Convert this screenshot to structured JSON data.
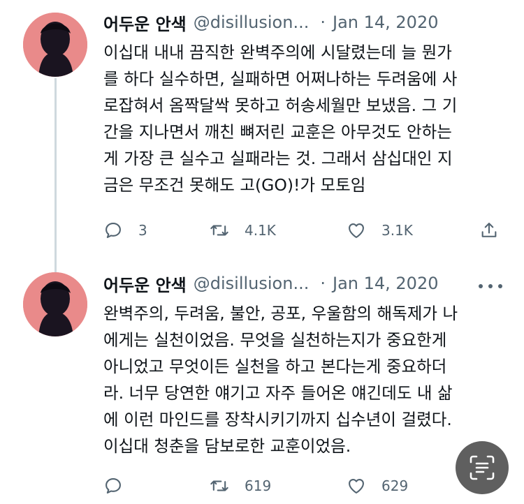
{
  "tweets": [
    {
      "name": "어두운 안색",
      "handle": "@disillusion...",
      "separator": "·",
      "date": "Jan 14, 2020",
      "lines": [
        "이십대 내내 끔직한 완벽주의에 시달렸는데 늘 뭔가",
        "를 하다 실수하면, 실패하면 어쩌나하는 두려움에 사",
        "로잡혀서 옴짝달싹 못하고 허송세월만 보냈음. 그 기",
        "간을 지나면서 깨친 뼈저린 교훈은 아무것도 안하는",
        "게 가장 큰 실수고 실패라는 것. 그래서 삼십대인 지",
        "금은 무조건 못해도 고(GO)!가 모토임"
      ],
      "reply_count": "3",
      "retweet_count": "4.1K",
      "like_count": "3.1K"
    },
    {
      "name": "어두운 안색",
      "handle": "@disillusion...",
      "separator": "·",
      "date": "Jan 14, 2020",
      "lines": [
        "완벽주의, 두려움, 불안, 공포, 우울함의 해독제가 나",
        "에게는 실천이었음. 무엇을 실천하는지가 중요한게",
        "아니었고 무엇이든 실천을 하고 본다는게 중요하더",
        "라. 너무 당연한 얘기고 자주 들어온 얘긴데도 내 삶",
        "에 이런 마인드를 장착시키기까지 십수년이 걸렸다.",
        "이십대 청춘을 담보로한 교훈이었음."
      ],
      "reply_count": "",
      "retweet_count": "619",
      "like_count": "629"
    }
  ],
  "icons": {
    "avatar": "avatar-silhouette",
    "more": "more-icon",
    "reply": "reply-icon",
    "retweet": "retweet-icon",
    "like": "heart-icon",
    "share": "share-icon",
    "scan": "text-scan-icon"
  },
  "colors": {
    "text": "#0f1419",
    "secondary": "#536471",
    "avatar_bg": "#e98a8a",
    "thread_line": "#cfd9de",
    "scan_button": "#5f5f5f"
  }
}
